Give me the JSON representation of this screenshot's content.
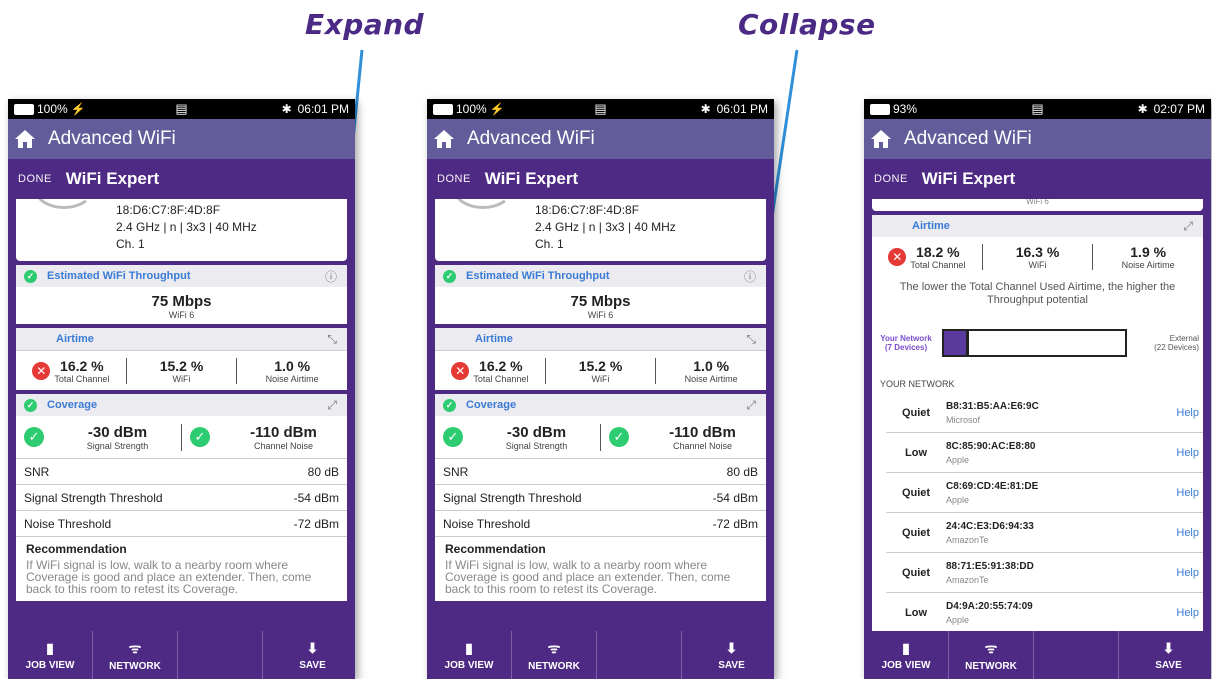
{
  "callouts": {
    "expand": "Expand",
    "collapse": "Collapse"
  },
  "colors": {
    "purple_dark": "#4e2a85",
    "appbar": "#635c9a",
    "accent_blue": "#3a7bd5",
    "ok_green": "#2ecc71",
    "error_red": "#e53935"
  },
  "phones": [
    {
      "status": {
        "battery": "100%",
        "time": "06:01 PM"
      },
      "app_title": "Advanced WiFi",
      "done_label": "DONE",
      "screen_title": "WiFi Expert",
      "network": {
        "bssid": "18:D6:C7:8F:4D:8F",
        "details": "2.4 GHz | n | 3x3 | 40 MHz",
        "channel": "Ch. 1"
      },
      "throughput": {
        "title": "Estimated WiFi Throughput",
        "value": "75 Mbps",
        "sub": "WiFi 6"
      },
      "airtime": {
        "title": "Airtime",
        "total": "16.2 %",
        "total_label": "Total Channel",
        "wifi": "15.2 %",
        "wifi_label": "WiFi",
        "noise": "1.0 %",
        "noise_label": "Noise Airtime"
      },
      "coverage": {
        "title": "Coverage",
        "signal": "-30 dBm",
        "signal_label": "Signal Strength",
        "noise": "-110 dBm",
        "noise_label": "Channel Noise"
      },
      "rows": [
        {
          "label": "SNR",
          "value": "80 dB"
        },
        {
          "label": "Signal Strength Threshold",
          "value": "-54 dBm"
        },
        {
          "label": "Noise Threshold",
          "value": "-72 dBm"
        }
      ],
      "recommendation": {
        "title": "Recommendation",
        "text": "If WiFi signal is low, walk to a nearby room where Coverage is good and place an extender. Then, come back to this room to retest its Coverage."
      },
      "bottom": {
        "job": "JOB VIEW",
        "network": "NETWORK",
        "save": "SAVE"
      }
    },
    {
      "status": {
        "battery": "100%",
        "time": "06:01 PM"
      },
      "app_title": "Advanced WiFi",
      "done_label": "DONE",
      "screen_title": "WiFi Expert",
      "network": {
        "bssid": "18:D6:C7:8F:4D:8F",
        "details": "2.4 GHz | n | 3x3 | 40 MHz",
        "channel": "Ch. 1"
      },
      "throughput": {
        "title": "Estimated WiFi Throughput",
        "value": "75 Mbps",
        "sub": "WiFi 6"
      },
      "airtime": {
        "title": "Airtime",
        "total": "16.2 %",
        "total_label": "Total Channel",
        "wifi": "15.2 %",
        "wifi_label": "WiFi",
        "noise": "1.0 %",
        "noise_label": "Noise Airtime"
      },
      "coverage": {
        "title": "Coverage",
        "signal": "-30 dBm",
        "signal_label": "Signal Strength",
        "noise": "-110 dBm",
        "noise_label": "Channel Noise"
      },
      "rows": [
        {
          "label": "SNR",
          "value": "80 dB"
        },
        {
          "label": "Signal Strength Threshold",
          "value": "-54 dBm"
        },
        {
          "label": "Noise Threshold",
          "value": "-72 dBm"
        }
      ],
      "recommendation": {
        "title": "Recommendation",
        "text": "If WiFi signal is low, walk to a nearby room where Coverage is good and place an extender. Then, come back to this room to retest its Coverage."
      },
      "bottom": {
        "job": "JOB VIEW",
        "network": "NETWORK",
        "save": "SAVE"
      }
    },
    {
      "status": {
        "battery": "93%",
        "time": "02:07 PM"
      },
      "app_title": "Advanced WiFi",
      "done_label": "DONE",
      "screen_title": "WiFi Expert",
      "top_cut": "WiFi 6",
      "airtime": {
        "title": "Airtime",
        "total": "18.2 %",
        "total_label": "Total Channel",
        "wifi": "16.3 %",
        "wifi_label": "WiFi",
        "noise": "1.9 %",
        "noise_label": "Noise Airtime"
      },
      "caption": "The lower the Total Channel Used Airtime, the higher the Throughput potential",
      "bar": {
        "left_label": "Your Network",
        "left_sub": "(7 Devices)",
        "right_label": "External",
        "right_sub": "(22 Devices)",
        "fill_fraction": 0.14
      },
      "your_network_label": "YOUR NETWORK",
      "help_label": "Help",
      "devices": [
        {
          "status": "Quiet",
          "mac": "B8:31:B5:AA:E6:9C",
          "vendor": "Microsof"
        },
        {
          "status": "Low",
          "mac": "8C:85:90:AC:E8:80",
          "vendor": "Apple"
        },
        {
          "status": "Quiet",
          "mac": "C8:69:CD:4E:81:DE",
          "vendor": "Apple"
        },
        {
          "status": "Quiet",
          "mac": "24:4C:E3:D6:94:33",
          "vendor": "AmazonTe"
        },
        {
          "status": "Quiet",
          "mac": "88:71:E5:91:38:DD",
          "vendor": "AmazonTe"
        },
        {
          "status": "Low",
          "mac": "D4:9A:20:55:74:09",
          "vendor": "Apple"
        }
      ],
      "bottom": {
        "job": "JOB VIEW",
        "network": "NETWORK",
        "save": "SAVE"
      }
    }
  ]
}
